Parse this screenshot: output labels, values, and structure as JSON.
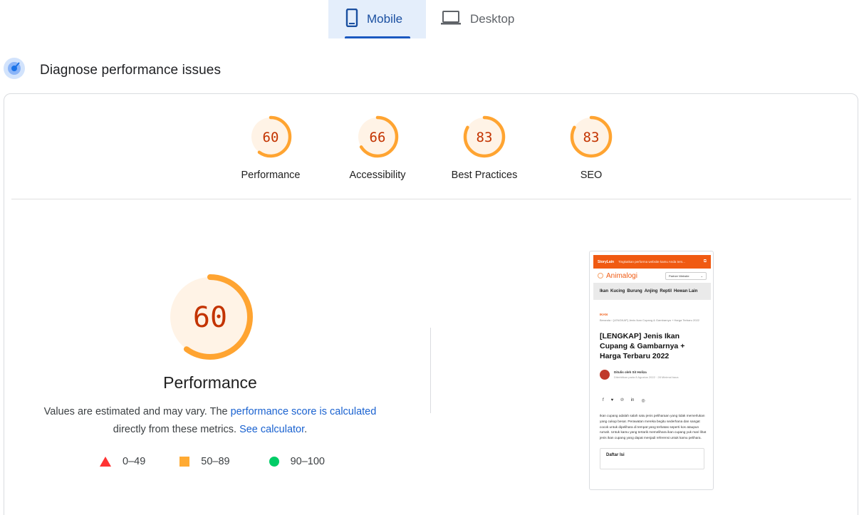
{
  "tabs": [
    {
      "label": "Mobile",
      "icon": "phone-icon",
      "active": true
    },
    {
      "label": "Desktop",
      "icon": "laptop-icon",
      "active": false
    }
  ],
  "section": {
    "title": "Diagnose performance issues",
    "icon": "diagnose-icon"
  },
  "scores": [
    {
      "label": "Performance",
      "value": 60
    },
    {
      "label": "Accessibility",
      "value": 66
    },
    {
      "label": "Best Practices",
      "value": 83
    },
    {
      "label": "SEO",
      "value": 83
    }
  ],
  "performance": {
    "score": 60,
    "label": "Performance",
    "desc_part1": "Values are estimated and may vary. The ",
    "desc_link1": "performance score is calculated",
    "desc_part2": "directly from these metrics. ",
    "desc_link2": "See calculator",
    "desc_end": "."
  },
  "legend": [
    {
      "range": "0–49",
      "shape": "triangle",
      "color": "#ff3333"
    },
    {
      "range": "50–89",
      "shape": "square",
      "color": "#ffaa33"
    },
    {
      "range": "90–100",
      "shape": "circle",
      "color": "#00cc66"
    }
  ],
  "colors": {
    "average": "#ffa431",
    "average_fill": "#fff3e6",
    "average_text": "#c33300",
    "accent": "#1a58c0"
  },
  "screenshot": {
    "topbar_brand": "StoryLain",
    "topbar_msg": "Tingkatkan performa website kamu Anda ters...",
    "logo": "Animalogi",
    "partner": "Partner Website",
    "nav": [
      "Ikan",
      "Kucing",
      "Burung",
      "Anjing",
      "Reptil",
      "Hewan Lain"
    ],
    "category": "IKAN",
    "breadcrumb": "Beranda › [LENGKAP] Jenis Ikan Cupang & Gambarnya + Harga Terbaru 2022",
    "title": "[LENGKAP] Jenis Ikan Cupang & Gambarnya + Harga Terbaru 2022",
    "author": "Ditulis oleh Sit Holiza",
    "date": "Diterbitkan pada 8 Agustus 2022 · 28 Minimal baca",
    "body": "Ikan cupang adalah salah satu jenis peliharaan yang tidak memerlukan yang cukup besar. Perawatan mereka begitu sederhana dan sangat cocok untuk dipelihara di tempat yang terbatas seperti kos ataupun rumah. Untuk kamu yang tertarik memelihara ikan cupang yuk mari lihat jenis ikan cupang yang dapat menjadi referensi untuk kamu pelihara.",
    "toc": "Daftar Isi"
  }
}
